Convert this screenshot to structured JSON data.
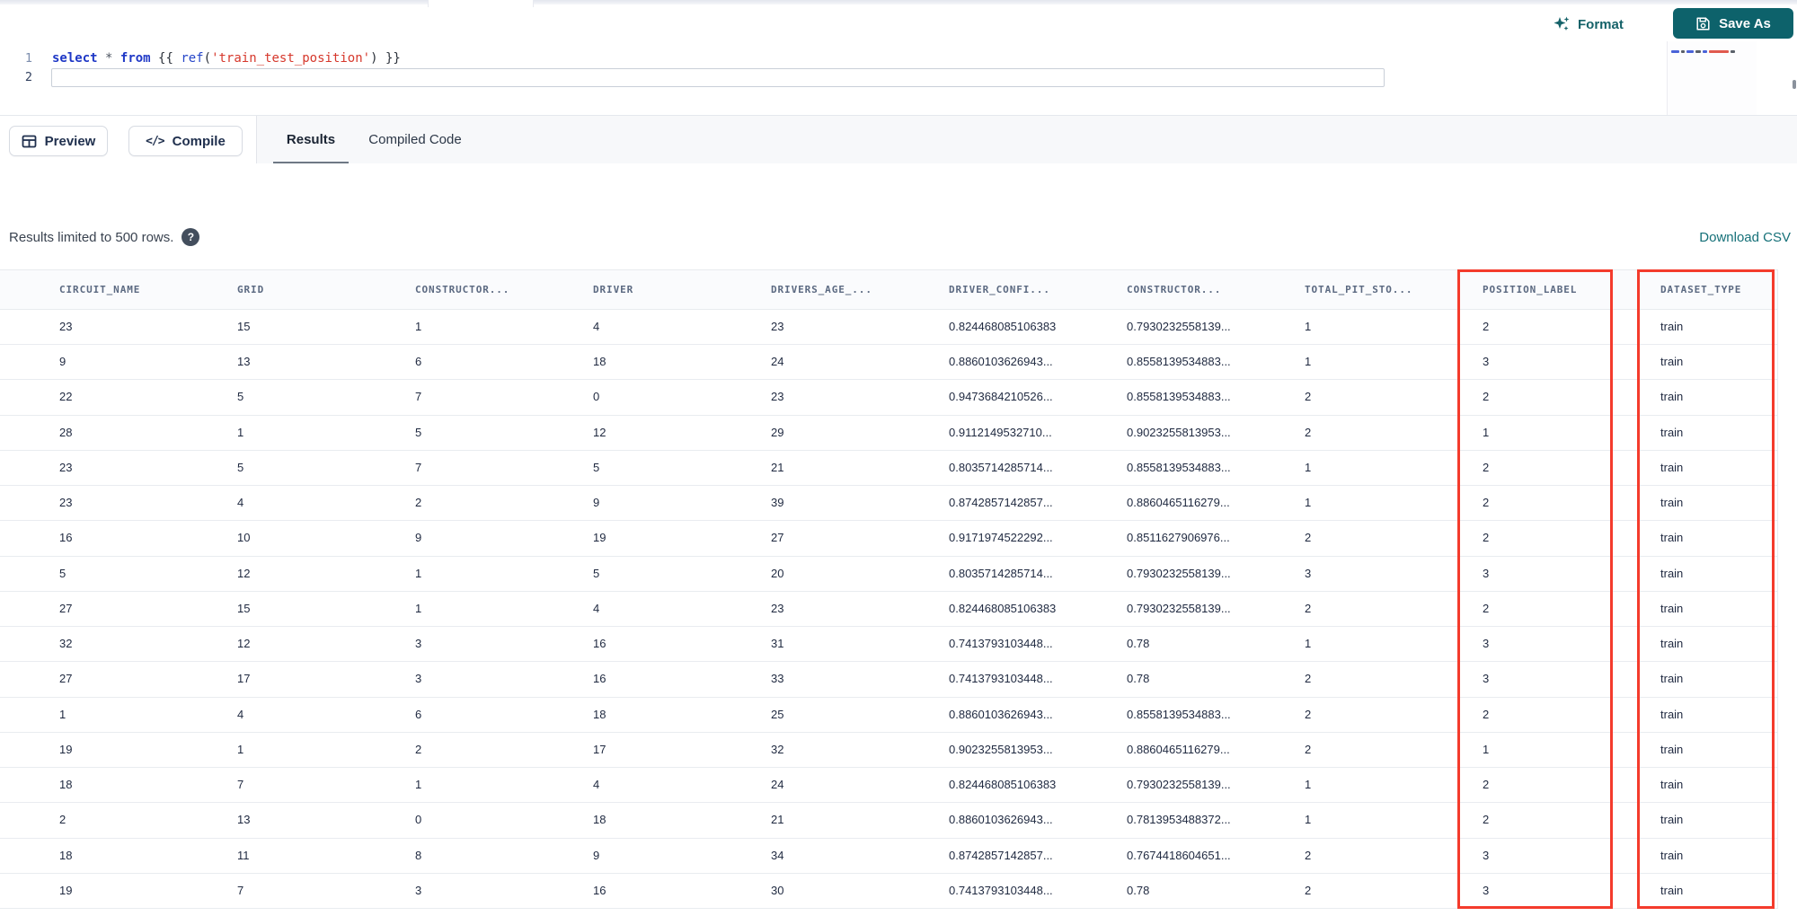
{
  "toolbar": {
    "format_label": "Format",
    "save_as_label": "Save As"
  },
  "editor": {
    "line_numbers": [
      "1",
      "2"
    ],
    "line1_text": "select * from {{ ref('train_test_position') }}",
    "line1_tokens": [
      {
        "text": "select",
        "type": "keyword"
      },
      {
        "text": " ",
        "type": "plain"
      },
      {
        "text": "*",
        "type": "operator"
      },
      {
        "text": " ",
        "type": "plain"
      },
      {
        "text": "from",
        "type": "keyword"
      },
      {
        "text": " {{ ",
        "type": "plain"
      },
      {
        "text": "ref",
        "type": "function"
      },
      {
        "text": "(",
        "type": "plain"
      },
      {
        "text": "'train_test_position'",
        "type": "string"
      },
      {
        "text": ")",
        "type": "plain"
      },
      {
        "text": " }}",
        "type": "plain"
      }
    ],
    "minimap_segments": [
      {
        "w": 9,
        "c": "#4a63d8"
      },
      {
        "w": 4,
        "c": "#5a6069"
      },
      {
        "w": 8,
        "c": "#4a63d8"
      },
      {
        "w": 6,
        "c": "#5a6069"
      },
      {
        "w": 5,
        "c": "#4a63d8"
      },
      {
        "w": 22,
        "c": "#e05a4e"
      },
      {
        "w": 5,
        "c": "#5a6069"
      }
    ]
  },
  "actions": {
    "preview_label": "Preview",
    "compile_label": "Compile",
    "compile_glyph": "</>"
  },
  "tabs": [
    {
      "label": "Results",
      "active": true
    },
    {
      "label": "Compiled Code",
      "active": false
    }
  ],
  "results_bar": {
    "note": "Results limited to 500 rows.",
    "help_glyph": "?",
    "download_label": "Download CSV"
  },
  "table": {
    "columns": [
      "CIRCUIT_NAME",
      "GRID",
      "CONSTRUCTOR...",
      "DRIVER",
      "DRIVERS_AGE_...",
      "DRIVER_CONFI...",
      "CONSTRUCTOR...",
      "TOTAL_PIT_STO...",
      "POSITION_LABEL",
      "DATASET_TYPE"
    ],
    "rows": [
      [
        "23",
        "15",
        "1",
        "4",
        "23",
        "0.824468085106383",
        "0.7930232558139...",
        "1",
        "2",
        "train"
      ],
      [
        "9",
        "13",
        "6",
        "18",
        "24",
        "0.8860103626943...",
        "0.8558139534883...",
        "1",
        "3",
        "train"
      ],
      [
        "22",
        "5",
        "7",
        "0",
        "23",
        "0.9473684210526...",
        "0.8558139534883...",
        "2",
        "2",
        "train"
      ],
      [
        "28",
        "1",
        "5",
        "12",
        "29",
        "0.9112149532710...",
        "0.9023255813953...",
        "2",
        "1",
        "train"
      ],
      [
        "23",
        "5",
        "7",
        "5",
        "21",
        "0.8035714285714...",
        "0.8558139534883...",
        "1",
        "2",
        "train"
      ],
      [
        "23",
        "4",
        "2",
        "9",
        "39",
        "0.8742857142857...",
        "0.8860465116279...",
        "1",
        "2",
        "train"
      ],
      [
        "16",
        "10",
        "9",
        "19",
        "27",
        "0.9171974522292...",
        "0.8511627906976...",
        "2",
        "2",
        "train"
      ],
      [
        "5",
        "12",
        "1",
        "5",
        "20",
        "0.8035714285714...",
        "0.7930232558139...",
        "3",
        "3",
        "train"
      ],
      [
        "27",
        "15",
        "1",
        "4",
        "23",
        "0.824468085106383",
        "0.7930232558139...",
        "2",
        "2",
        "train"
      ],
      [
        "32",
        "12",
        "3",
        "16",
        "31",
        "0.7413793103448...",
        "0.78",
        "1",
        "3",
        "train"
      ],
      [
        "27",
        "17",
        "3",
        "16",
        "33",
        "0.7413793103448...",
        "0.78",
        "2",
        "3",
        "train"
      ],
      [
        "1",
        "4",
        "6",
        "18",
        "25",
        "0.8860103626943...",
        "0.8558139534883...",
        "2",
        "2",
        "train"
      ],
      [
        "19",
        "1",
        "2",
        "17",
        "32",
        "0.9023255813953...",
        "0.8860465116279...",
        "2",
        "1",
        "train"
      ],
      [
        "18",
        "7",
        "1",
        "4",
        "24",
        "0.824468085106383",
        "0.7930232558139...",
        "1",
        "2",
        "train"
      ],
      [
        "2",
        "13",
        "0",
        "18",
        "21",
        "0.8860103626943...",
        "0.7813953488372...",
        "1",
        "2",
        "train"
      ],
      [
        "18",
        "11",
        "8",
        "9",
        "34",
        "0.8742857142857...",
        "0.7674418604651...",
        "2",
        "3",
        "train"
      ],
      [
        "19",
        "7",
        "3",
        "16",
        "30",
        "0.7413793103448...",
        "0.78",
        "2",
        "3",
        "train"
      ]
    ]
  },
  "annotations": {
    "highlight_color": "#f43b2c",
    "highlighted_columns": [
      "POSITION_LABEL",
      "DATASET_TYPE"
    ]
  },
  "colors": {
    "accent_teal": "#0d626b",
    "link_teal": "#157078",
    "keyword_blue": "#1f38c6",
    "string_red": "#d6382c"
  }
}
